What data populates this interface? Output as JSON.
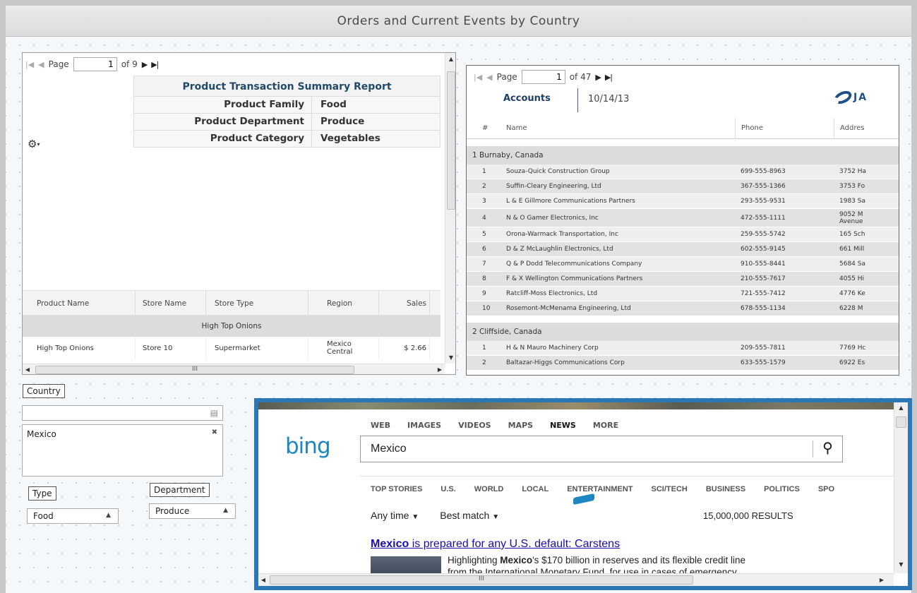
{
  "title": "Orders and Current Events by Country",
  "left_report": {
    "pager": {
      "label": "Page",
      "current": "1",
      "of_label": "of 9"
    },
    "report_title": "Product Transaction Summary Report",
    "params": [
      {
        "label": "Product Family",
        "value": "Food"
      },
      {
        "label": "Product Department",
        "value": "Produce"
      },
      {
        "label": "Product Category",
        "value": "Vegetables"
      }
    ],
    "columns": [
      "Product Name",
      "Store Name",
      "Store Type",
      "Region",
      "Sales"
    ],
    "group": "High Top Onions",
    "row": {
      "product": "High Top Onions",
      "store": "Store 10",
      "type": "Supermarket",
      "region": "Mexico Central",
      "sales": "$ 2.66"
    },
    "scroll_thumb_label": "III"
  },
  "right_report": {
    "pager": {
      "label": "Page",
      "current": "1",
      "of_label": "of 47"
    },
    "title": "Accounts",
    "date": "10/14/13",
    "logo_text": "JA",
    "columns": [
      "#",
      "Name",
      "Phone",
      "Addres"
    ],
    "groups": [
      {
        "label": "1  Burnaby, Canada",
        "rows": [
          {
            "n": "1",
            "name": "Souza-Quick Construction Group",
            "phone": "699-555-8963",
            "addr": "3752 Ha"
          },
          {
            "n": "2",
            "name": "Suffin-Cleary Engineering, Ltd",
            "phone": "367-555-1366",
            "addr": "3753 Fo"
          },
          {
            "n": "3",
            "name": "L & E Gillmore Communications Partners",
            "phone": "293-555-9531",
            "addr": "1983 Sa"
          },
          {
            "n": "4",
            "name": "N & O Gamer Electronics, Inc",
            "phone": "472-555-1111",
            "addr": "9052 M",
            "addr2": "Avenue"
          },
          {
            "n": "5",
            "name": "Orona-Warmack Transportation, Inc",
            "phone": "259-555-5742",
            "addr": "165 Sch"
          },
          {
            "n": "6",
            "name": "D & Z McLaughlin Electronics, Ltd",
            "phone": "602-555-9145",
            "addr": "661 Mill"
          },
          {
            "n": "7",
            "name": "Q & P Dodd Telecommunications Company",
            "phone": "910-555-8441",
            "addr": "5684 Sa"
          },
          {
            "n": "8",
            "name": "F & X Wellington Communications Partners",
            "phone": "210-555-7617",
            "addr": "4055 Hi"
          },
          {
            "n": "9",
            "name": "Ratcliff-Moss Electronics, Ltd",
            "phone": "721-555-7412",
            "addr": "4776 Ke"
          },
          {
            "n": "10",
            "name": "Rosemont-McMenama Engineering, Ltd",
            "phone": "678-555-1134",
            "addr": "6228 M"
          }
        ]
      },
      {
        "label": "2  Cliffside, Canada",
        "rows": [
          {
            "n": "1",
            "name": "H & N Mauro Machinery Corp",
            "phone": "209-555-7811",
            "addr": "7769 Hc"
          },
          {
            "n": "2",
            "name": "Baltazar-Higgs Communications Corp",
            "phone": "633-555-1579",
            "addr": "6922 Es"
          }
        ]
      }
    ]
  },
  "filters": {
    "country_label": "Country",
    "country_selected": "Mexico",
    "type_label": "Type",
    "type_value": "Food",
    "department_label": "Department",
    "department_value": "Produce"
  },
  "bing": {
    "nav": [
      "WEB",
      "IMAGES",
      "VIDEOS",
      "MAPS",
      "NEWS",
      "MORE"
    ],
    "active_nav": "NEWS",
    "logo": "bing",
    "query": "Mexico",
    "subnav": [
      "TOP STORIES",
      "U.S.",
      "WORLD",
      "LOCAL",
      "ENTERTAINMENT",
      "SCI/TECH",
      "BUSINESS",
      "POLITICS",
      "SPO"
    ],
    "time_filter": "Any time",
    "sort_filter": "Best match",
    "results_count": "15,000,000 RESULTS",
    "result_title_bold": "Mexico",
    "result_title_rest": " is prepared for any U.S. default: Carstens",
    "snippet_line1_pre": "Highlighting ",
    "snippet_line1_bold": "Mexico",
    "snippet_line1_post": "'s $170 billion in reserves and its flexible credit line",
    "snippet_line2": "from the International Monetary Fund, for use in cases of emergency",
    "scroll_thumb_label": "III"
  }
}
